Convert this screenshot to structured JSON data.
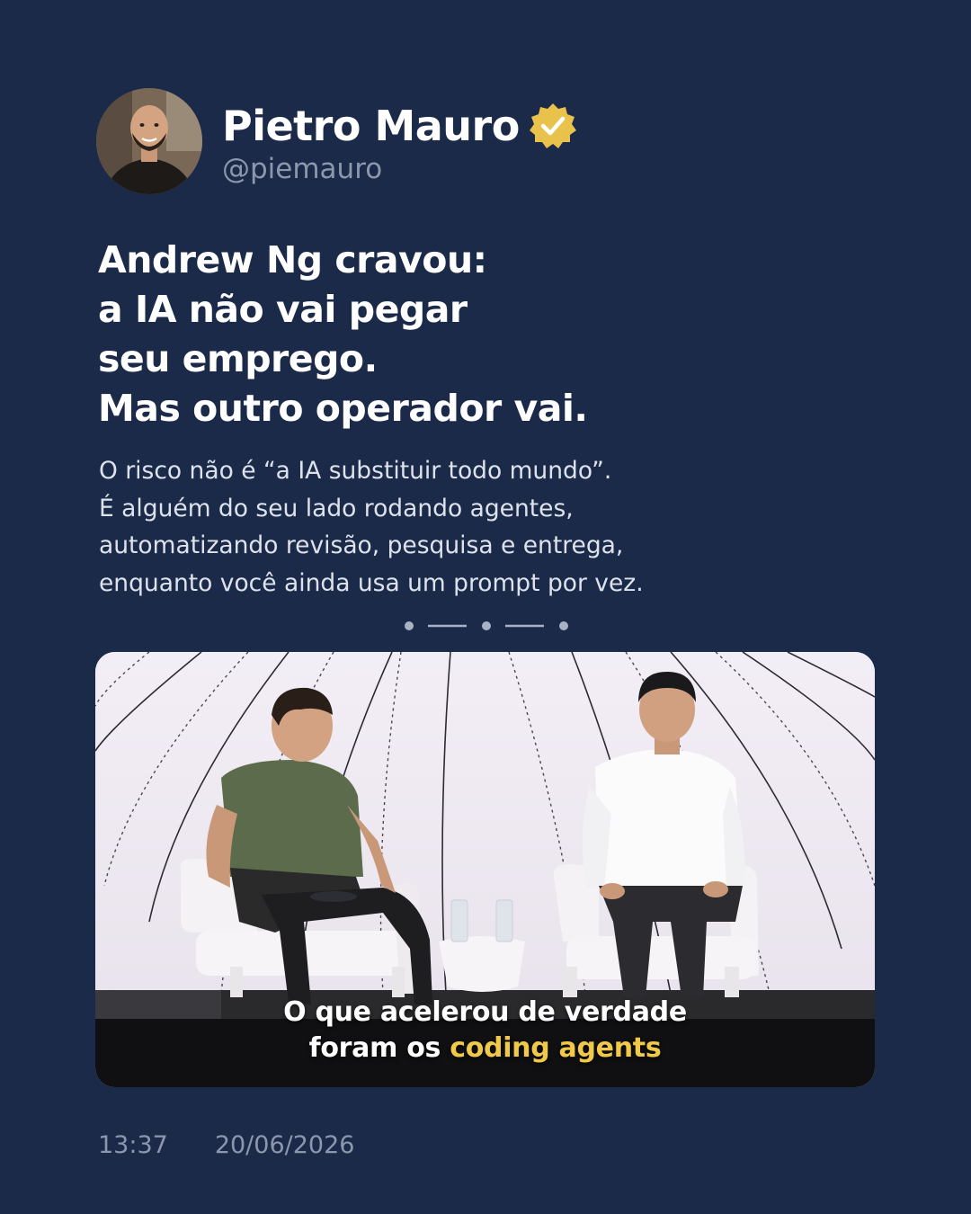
{
  "author": {
    "name": "Pietro Mauro",
    "handle": "@piemauro",
    "verified_icon": "verified-badge-icon",
    "badge_color": "#e8c24a"
  },
  "headline_lines": [
    "Andrew Ng cravou:",
    "a IA não vai pegar",
    "seu emprego.",
    "Mas outro operador vai."
  ],
  "body_lines": [
    "O risco não é “a IA substituir todo mundo”.",
    "É alguém do seu lado rodando agentes,",
    "automatizando revisão, pesquisa e entrega,",
    "enquanto você ainda usa um prompt por vez."
  ],
  "media": {
    "caption_line1": "O que acelerou de verdade",
    "caption_line2_prefix": "foram os ",
    "caption_line2_highlight": "coding agents",
    "highlight_color": "#f0c94a"
  },
  "footer": {
    "time": "13:37",
    "date": "20/06/2026"
  },
  "colors": {
    "background": "#1b2a48",
    "muted_text": "#8c97ad"
  }
}
